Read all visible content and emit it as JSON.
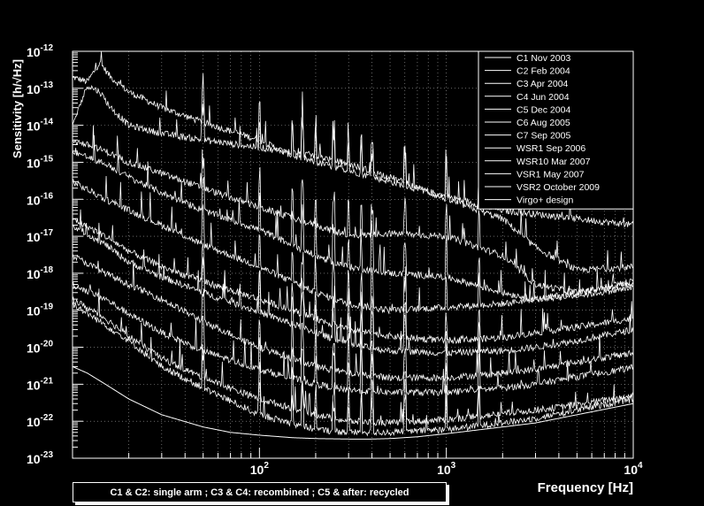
{
  "chart_data": {
    "type": "line",
    "xlabel": "Frequency [Hz]",
    "ylabel": "Sensitivity [h/√Hz]",
    "xscale": "log",
    "yscale": "log",
    "xlim": [
      10,
      10000
    ],
    "ylim": [
      1e-23,
      1e-12
    ],
    "x_ticks": [
      {
        "value": 100,
        "base": "10",
        "exp": "2"
      },
      {
        "value": 1000,
        "base": "10",
        "exp": "3"
      },
      {
        "value": 10000,
        "base": "10",
        "exp": "4"
      }
    ],
    "y_ticks": [
      {
        "value": 1e-12,
        "base": "10",
        "exp": "-12"
      },
      {
        "value": 1e-13,
        "base": "10",
        "exp": "-13"
      },
      {
        "value": 1e-14,
        "base": "10",
        "exp": "-14"
      },
      {
        "value": 1e-15,
        "base": "10",
        "exp": "-15"
      },
      {
        "value": 1e-16,
        "base": "10",
        "exp": "-16"
      },
      {
        "value": 1e-17,
        "base": "10",
        "exp": "-17"
      },
      {
        "value": 1e-18,
        "base": "10",
        "exp": "-18"
      },
      {
        "value": 1e-19,
        "base": "10",
        "exp": "-19"
      },
      {
        "value": 1e-20,
        "base": "10",
        "exp": "-20"
      },
      {
        "value": 1e-21,
        "base": "10",
        "exp": "-21"
      },
      {
        "value": 1e-22,
        "base": "10",
        "exp": "-22"
      },
      {
        "value": 1e-23,
        "base": "10",
        "exp": "-23"
      }
    ],
    "grid": true,
    "legend_position": "top-right",
    "background_color": "#000000",
    "line_color": "#ffffff",
    "series": [
      {
        "name": "C1 Nov 2003",
        "x": [
          10,
          12,
          14,
          16,
          20,
          30,
          50,
          100,
          150,
          200,
          300,
          500,
          1000,
          2000,
          3000,
          5000,
          10000
        ],
        "values": [
          2e-13,
          1.5e-13,
          5e-13,
          2e-13,
          8e-14,
          3e-14,
          1.2e-14,
          4e-15,
          1.5e-15,
          1e-15,
          6e-16,
          3e-16,
          1.2e-16,
          5e-17,
          4e-17,
          3e-17,
          2e-17
        ]
      },
      {
        "name": "C2 Feb 2004",
        "x": [
          10,
          12,
          14,
          16,
          20,
          30,
          50,
          100,
          200,
          300,
          500,
          1000,
          2000,
          3000,
          5000,
          10000
        ],
        "values": [
          1e-14,
          1.2e-13,
          8e-14,
          3e-14,
          1e-14,
          6e-15,
          4e-15,
          2.5e-15,
          1.5e-15,
          9e-16,
          4e-16,
          1e-16,
          3e-17,
          5e-18,
          1.2e-18,
          1.5e-18
        ]
      },
      {
        "name": "C3 Apr 2004",
        "x": [
          10,
          15,
          20,
          30,
          50,
          100,
          200,
          300,
          500,
          1000,
          2000,
          3000,
          5000,
          10000
        ],
        "values": [
          4e-15,
          2e-15,
          1e-15,
          5e-16,
          2e-16,
          6e-17,
          2e-17,
          1e-17,
          1.2e-17,
          1e-17,
          3e-18,
          5e-19,
          3e-19,
          6e-19
        ]
      },
      {
        "name": "C4 Jun 2004",
        "x": [
          10,
          15,
          20,
          30,
          50,
          100,
          200,
          300,
          500,
          1000,
          2000,
          3000,
          5000,
          10000
        ],
        "values": [
          2e-15,
          9e-16,
          4e-16,
          1.5e-16,
          5e-17,
          1.5e-17,
          3e-18,
          1.5e-18,
          1e-18,
          8e-19,
          3e-19,
          2e-19,
          3e-19,
          5e-19
        ]
      },
      {
        "name": "C5 Dec 2004",
        "x": [
          10,
          15,
          20,
          30,
          50,
          100,
          200,
          300,
          500,
          1000,
          2000,
          3000,
          5000,
          10000
        ],
        "values": [
          3e-16,
          1e-16,
          5e-17,
          2e-17,
          6e-18,
          1.5e-18,
          3e-19,
          1.5e-19,
          1e-19,
          1.2e-19,
          1.5e-19,
          2e-19,
          2.5e-19,
          4e-19
        ]
      },
      {
        "name": "C6 Aug 2005",
        "x": [
          10,
          15,
          20,
          30,
          50,
          100,
          200,
          300,
          500,
          1000,
          2000,
          3000,
          5000,
          10000
        ],
        "values": [
          3e-17,
          1e-17,
          4e-18,
          1.5e-18,
          6e-19,
          2e-19,
          6e-20,
          3e-20,
          2e-20,
          1.5e-20,
          1.8e-20,
          2.5e-20,
          3.5e-20,
          6e-20
        ]
      },
      {
        "name": "C7 Sep 2005",
        "x": [
          10,
          15,
          20,
          30,
          50,
          100,
          200,
          300,
          500,
          1000,
          2000,
          3000,
          5000,
          10000
        ],
        "values": [
          2e-17,
          6e-18,
          2e-18,
          8e-19,
          3e-19,
          9e-20,
          2.5e-20,
          1.2e-20,
          8e-21,
          7e-21,
          8e-21,
          1e-20,
          1.5e-20,
          3e-20
        ]
      },
      {
        "name": "WSR1 Sep 2006",
        "x": [
          10,
          15,
          20,
          30,
          50,
          100,
          200,
          300,
          500,
          1000,
          2000,
          3000,
          5000,
          10000
        ],
        "values": [
          3e-18,
          1e-18,
          5e-19,
          2e-19,
          5e-20,
          1e-20,
          3e-21,
          2e-21,
          1.5e-21,
          1.5e-21,
          2e-21,
          2.5e-21,
          4e-21,
          7e-21
        ]
      },
      {
        "name": "WSR10 Mar 2007",
        "x": [
          10,
          15,
          20,
          30,
          50,
          100,
          200,
          300,
          500,
          1000,
          2000,
          3000,
          5000,
          10000
        ],
        "values": [
          5e-19,
          2e-19,
          8e-20,
          2.5e-20,
          8e-21,
          2.5e-21,
          1e-21,
          7e-22,
          6e-22,
          6e-22,
          8e-22,
          1e-21,
          1.6e-21,
          2.8e-21
        ]
      },
      {
        "name": "VSR1 May 2007",
        "x": [
          10,
          15,
          20,
          30,
          50,
          100,
          200,
          300,
          500,
          1000,
          2000,
          3000,
          5000,
          10000
        ],
        "values": [
          2e-19,
          6e-20,
          2e-20,
          5e-21,
          1.5e-21,
          4e-22,
          1.5e-22,
          1e-22,
          9e-23,
          1.1e-22,
          1.6e-22,
          2e-22,
          2.8e-22,
          5e-22
        ]
      },
      {
        "name": "VSR2 October 2009",
        "x": [
          10,
          15,
          20,
          30,
          50,
          100,
          200,
          300,
          500,
          1000,
          2000,
          3000,
          5000,
          10000
        ],
        "values": [
          1.5e-19,
          4e-20,
          1.5e-20,
          3e-21,
          8e-22,
          1.5e-22,
          6e-23,
          5e-23,
          5e-23,
          6e-23,
          9e-23,
          1.2e-22,
          2e-22,
          4e-22
        ]
      },
      {
        "name": "Virgo+ design",
        "x": [
          10,
          12,
          15,
          20,
          30,
          50,
          70,
          100,
          150,
          200,
          300,
          400,
          500,
          700,
          1000,
          2000,
          3000,
          5000,
          10000
        ],
        "values": [
          3e-21,
          2e-21,
          1e-21,
          4e-22,
          1.5e-22,
          7e-23,
          5e-23,
          4.2e-23,
          3.6e-23,
          3.4e-23,
          3.3e-23,
          3.3e-23,
          3.4e-23,
          3.8e-23,
          4.6e-23,
          7e-23,
          9e-23,
          1.5e-22,
          3e-22
        ]
      }
    ]
  },
  "note": "C1 & C2: single arm ; C3 & C4: recombined ; C5 & after: recycled"
}
